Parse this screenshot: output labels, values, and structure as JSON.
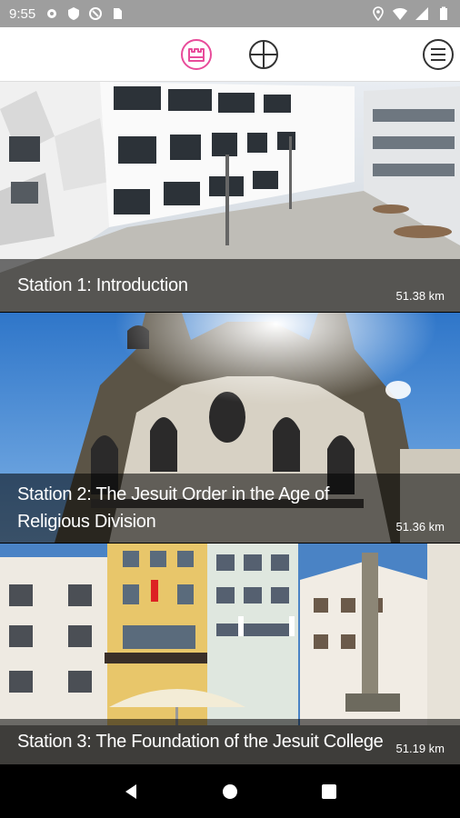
{
  "status_bar": {
    "time": "9:55"
  },
  "toolbar": {
    "accent_color": "#e84c9a",
    "icons": [
      "home-icon",
      "crosshair-icon",
      "menu-icon"
    ]
  },
  "stations": [
    {
      "title": "Station 1: Introduction",
      "distance": "51.38 km"
    },
    {
      "title": "Station 2: The Jesuit Order in the Age of Religious Division",
      "distance": "51.36 km"
    },
    {
      "title": "Station 3: The Foundation of the Jesuit College",
      "distance": "51.19 km"
    }
  ]
}
